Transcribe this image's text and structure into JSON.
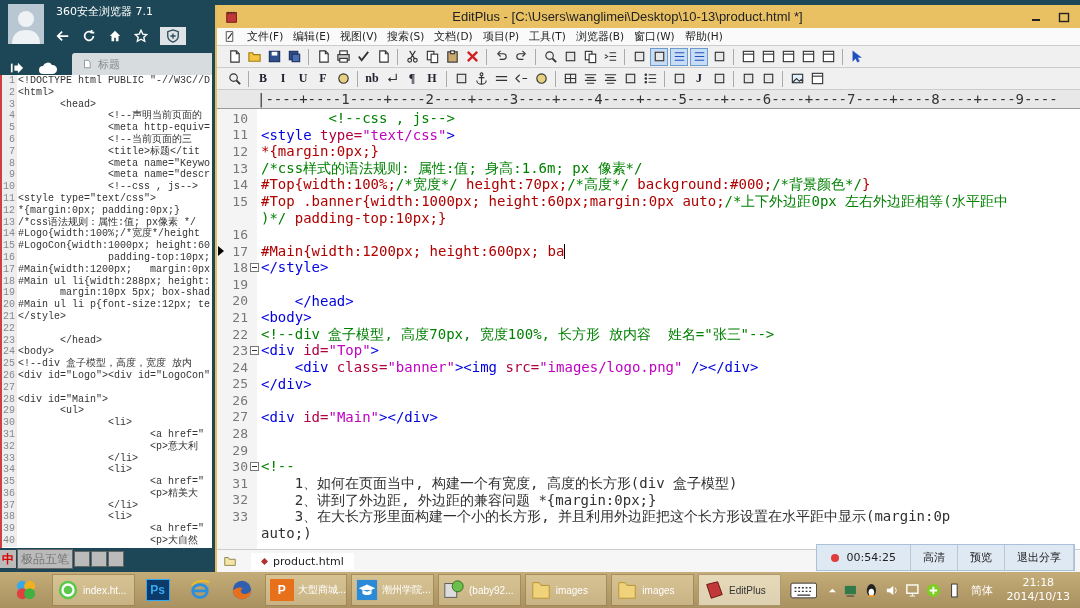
{
  "browser": {
    "title": "360安全浏览器 7.1",
    "tab": "标题",
    "lines": [
      {
        "num": "1",
        "text": "<!DOCTYPE html PUBLIC \"-//W3C//D"
      },
      {
        "num": "2",
        "text": "<html>"
      },
      {
        "num": "3",
        "text": "       <head>"
      },
      {
        "num": "4",
        "text": "               <!--声明当前页面的"
      },
      {
        "num": "5",
        "text": "               <meta http-equiv="
      },
      {
        "num": "6",
        "text": "               <!--当前页面的三"
      },
      {
        "num": "7",
        "text": "               <title>标题</tit"
      },
      {
        "num": "8",
        "text": "               <meta name=\"Keywo"
      },
      {
        "num": "9",
        "text": "               <meta name=\"descr"
      },
      {
        "num": "10",
        "text": "               <!--css , js-->"
      },
      {
        "num": "11",
        "text": "<style type=\"text/css\">"
      },
      {
        "num": "12",
        "text": "*{margin:0px; padding:0px;}"
      },
      {
        "num": "13",
        "text": "/*css语法规则：属性:值; px像素 */"
      },
      {
        "num": "14",
        "text": "#Logo{width:100%;/*宽度*/height"
      },
      {
        "num": "15",
        "text": "#LogoCon{width:1000px; height:60"
      },
      {
        "num": "16",
        "text": "               padding-top:10px;"
      },
      {
        "num": "17",
        "text": "#Main{width:1200px;   margin:0px"
      },
      {
        "num": "18",
        "text": "#Main ul li{width:288px; height:"
      },
      {
        "num": "19",
        "text": "       margin:10px 5px; box-shad"
      },
      {
        "num": "20",
        "text": "#Main ul li p{font-size:12px; te"
      },
      {
        "num": "21",
        "text": "</style>"
      },
      {
        "num": "22"
      },
      {
        "num": "23",
        "text": "       </head>"
      },
      {
        "num": "24",
        "text": "<body>"
      },
      {
        "num": "25",
        "text": "<!--div 盒子模型，高度，宽度 放内"
      },
      {
        "num": "26",
        "text": "<div id=\"Logo\"><div id=\"LogoCon\""
      },
      {
        "num": "27"
      },
      {
        "num": "28",
        "text": "<div id=\"Main\">"
      },
      {
        "num": "29",
        "text": "       <ul>"
      },
      {
        "num": "30",
        "text": "               <li>"
      },
      {
        "num": "31",
        "text": "                      <a href=\""
      },
      {
        "num": "32",
        "text": "                      <p>意大利"
      },
      {
        "num": "33",
        "text": "               </li>"
      },
      {
        "num": "34",
        "text": "               <li>"
      },
      {
        "num": "35",
        "text": "                      <a href=\""
      },
      {
        "num": "36",
        "text": "                      <p>精美大"
      },
      {
        "num": "37",
        "text": "               </li>"
      },
      {
        "num": "38",
        "text": "               <li>"
      },
      {
        "num": "39",
        "text": "                      <a href=\""
      },
      {
        "num": "40",
        "text": "                      <p>大自然"
      }
    ]
  },
  "ime": {
    "mode": "中",
    "name": "极品五笔"
  },
  "editor": {
    "title": "EditPlus - [C:\\Users\\wanglimei\\Desktop\\10-13\\product.html *]",
    "menu": [
      "文件(F)",
      "编辑(E)",
      "视图(V)",
      "搜索(S)",
      "文档(D)",
      "项目(P)",
      "工具(T)",
      "浏览器(B)",
      "窗口(W)",
      "帮助(H)"
    ],
    "toolbar_1": [
      {
        "kind": "button",
        "selected": false
      },
      {
        "kind": "button",
        "selected": false
      },
      {
        "kind": "button",
        "selected": false
      },
      {
        "kind": "button",
        "selected": false
      },
      {
        "kind": "sep"
      },
      {
        "kind": "button",
        "selected": false
      },
      {
        "kind": "button",
        "selected": false
      },
      {
        "kind": "button",
        "selected": false
      },
      {
        "kind": "button",
        "selected": false
      },
      {
        "kind": "sep"
      },
      {
        "kind": "button",
        "selected": false
      },
      {
        "kind": "button",
        "selected": false
      },
      {
        "kind": "button",
        "selected": false
      },
      {
        "kind": "button",
        "selected": false
      },
      {
        "kind": "sep"
      },
      {
        "kind": "button",
        "selected": false
      },
      {
        "kind": "button",
        "selected": false
      },
      {
        "kind": "sep"
      },
      {
        "kind": "button",
        "selected": false
      },
      {
        "kind": "button",
        "selected": false
      },
      {
        "kind": "button",
        "selected": false
      },
      {
        "kind": "button",
        "selected": false
      },
      {
        "kind": "sep"
      },
      {
        "kind": "button",
        "selected": false
      },
      {
        "kind": "button",
        "selected": true
      },
      {
        "kind": "button",
        "selected": true
      },
      {
        "kind": "button",
        "selected": true
      },
      {
        "kind": "button",
        "selected": false
      },
      {
        "kind": "sep"
      },
      {
        "kind": "button",
        "selected": false
      },
      {
        "kind": "button",
        "selected": false
      },
      {
        "kind": "button",
        "selected": false
      },
      {
        "kind": "button",
        "selected": false
      },
      {
        "kind": "button",
        "selected": false
      },
      {
        "kind": "sep"
      },
      {
        "kind": "button",
        "selected": false
      }
    ],
    "toolbar_2": [
      {
        "kind": "button"
      },
      {
        "kind": "sep"
      },
      {
        "kind": "text",
        "label": "B"
      },
      {
        "kind": "text",
        "label": "I"
      },
      {
        "kind": "text",
        "label": "U"
      },
      {
        "kind": "text",
        "label": "F"
      },
      {
        "kind": "button"
      },
      {
        "kind": "sep"
      },
      {
        "kind": "text",
        "label": "nb"
      },
      {
        "kind": "button"
      },
      {
        "kind": "text",
        "label": "¶"
      },
      {
        "kind": "text",
        "label": "H"
      },
      {
        "kind": "sep"
      },
      {
        "kind": "button"
      },
      {
        "kind": "button"
      },
      {
        "kind": "button"
      },
      {
        "kind": "button"
      },
      {
        "kind": "button"
      },
      {
        "kind": "sep"
      },
      {
        "kind": "button"
      },
      {
        "kind": "button"
      },
      {
        "kind": "button"
      },
      {
        "kind": "button"
      },
      {
        "kind": "button"
      },
      {
        "kind": "sep"
      },
      {
        "kind": "button"
      },
      {
        "kind": "text",
        "label": "J"
      },
      {
        "kind": "button"
      },
      {
        "kind": "sep"
      },
      {
        "kind": "button"
      },
      {
        "kind": "button"
      },
      {
        "kind": "sep"
      },
      {
        "kind": "button"
      },
      {
        "kind": "button"
      }
    ],
    "ruler": "|----+----1----+----2----+----3----+----4----+----5----+----6----+----7----+----8----+----9----",
    "lines": [
      {
        "num": "10",
        "tokens": [
          {
            "text": "        <!--css , js-->",
            "kind": "comment"
          }
        ]
      },
      {
        "num": "11",
        "tokens": [
          {
            "text": "<style ",
            "kind": "tag"
          },
          {
            "text": "type=",
            "kind": "attr"
          },
          {
            "text": "\"text/css\"",
            "kind": "val"
          },
          {
            "text": ">",
            "kind": "tag"
          }
        ]
      },
      {
        "num": "12",
        "tokens": [
          {
            "text": "*{margin:0px;}",
            "kind": "css"
          }
        ]
      },
      {
        "num": "13",
        "tokens": [
          {
            "text": "/*css样式的语法规则: 属性:值; 身高:1.6m; px 像素*/",
            "kind": "comment"
          }
        ]
      },
      {
        "num": "14",
        "tokens": [
          {
            "text": "#Top{width:100%;",
            "kind": "css"
          },
          {
            "text": "/*宽度*/",
            "kind": "comment"
          },
          {
            "text": " height:70px;",
            "kind": "css"
          },
          {
            "text": "/*高度*/",
            "kind": "comment"
          },
          {
            "text": " background:#000;",
            "kind": "css"
          },
          {
            "text": "/*背景颜色*/",
            "kind": "comment"
          },
          {
            "text": "}",
            "kind": "css"
          }
        ]
      },
      {
        "num": "15",
        "tokens": [
          {
            "text": "#Top .banner{width:1000px; height:60px;margin:0px auto;",
            "kind": "css"
          },
          {
            "text": "/*上下外边距0px 左右外边距相等(水平距中",
            "kind": "comment"
          }
        ]
      },
      {
        "tokens": [
          {
            "text": ")*/",
            "kind": "comment"
          },
          {
            "text": " padding-top:10px;}",
            "kind": "css"
          }
        ]
      },
      {
        "num": "16"
      },
      {
        "num": "17",
        "marker": true,
        "cursor": true,
        "tokens": [
          {
            "text": "#Main{width:1200px; height:600px; ba",
            "kind": "css"
          }
        ]
      },
      {
        "num": "18",
        "fold": true,
        "tokens": [
          {
            "text": "</style>",
            "kind": "tag"
          }
        ]
      },
      {
        "num": "19"
      },
      {
        "num": "20",
        "tokens": [
          {
            "text": "    </head>",
            "kind": "tag"
          }
        ]
      },
      {
        "num": "21",
        "tokens": [
          {
            "text": "<body>",
            "kind": "tag"
          }
        ]
      },
      {
        "num": "22",
        "tokens": [
          {
            "text": "<!--div 盒子模型, 高度70px, 宽度100%, 长方形 放内容  姓名=\"张三\"-->",
            "kind": "comment"
          }
        ]
      },
      {
        "num": "23",
        "fold": true,
        "tokens": [
          {
            "text": "<div ",
            "kind": "tag"
          },
          {
            "text": "id=",
            "kind": "attr"
          },
          {
            "text": "\"Top\"",
            "kind": "val"
          },
          {
            "text": ">",
            "kind": "tag"
          }
        ]
      },
      {
        "num": "24",
        "tokens": [
          {
            "text": "    <div ",
            "kind": "tag"
          },
          {
            "text": "class=",
            "kind": "attr"
          },
          {
            "text": "\"banner\"",
            "kind": "val"
          },
          {
            "text": "><img ",
            "kind": "tag"
          },
          {
            "text": "src=",
            "kind": "attr"
          },
          {
            "text": "\"images/logo.png\"",
            "kind": "val"
          },
          {
            "text": " /></div>",
            "kind": "tag"
          }
        ]
      },
      {
        "num": "25",
        "tokens": [
          {
            "text": "</div>",
            "kind": "tag"
          }
        ]
      },
      {
        "num": "26"
      },
      {
        "num": "27",
        "tokens": [
          {
            "text": "<div ",
            "kind": "tag"
          },
          {
            "text": "id=",
            "kind": "attr"
          },
          {
            "text": "\"Main\"",
            "kind": "val"
          },
          {
            "text": "></div>",
            "kind": "tag"
          }
        ]
      },
      {
        "num": "28"
      },
      {
        "num": "29"
      },
      {
        "num": "30",
        "fold": true,
        "tokens": [
          {
            "text": "<!--",
            "kind": "comment"
          }
        ]
      },
      {
        "num": "31",
        "tokens": [
          {
            "text": "    1、如何在页面当中, 构建一个有宽度, 高度的长方形(div 盒子模型)",
            "kind": "note"
          }
        ]
      },
      {
        "num": "32",
        "tokens": [
          {
            "text": "    2、讲到了外边距, 外边距的兼容问题 *{margin:0px;}",
            "kind": "note"
          }
        ]
      },
      {
        "num": "33",
        "tokens": [
          {
            "text": "    3、在大长方形里面构建一个小的长方形, 并且利用外边距把这个长方形设置在水平距中显示(margin:0p",
            "kind": "note"
          }
        ]
      },
      {
        "tokens": [
          {
            "text": "auto;)",
            "kind": "note"
          }
        ]
      }
    ],
    "documents": [
      {
        "label": "product.html",
        "selected": true
      }
    ]
  },
  "recorder": {
    "recording": true,
    "time": "00:54:25",
    "buttons": [
      "高清",
      "预览",
      "退出分享"
    ]
  },
  "taskbar": {
    "items": [
      {
        "kind": "orb",
        "selected": false
      },
      {
        "kind": "browser",
        "label": "index.ht...",
        "selected": false
      },
      {
        "kind": "badge",
        "badge": "Ps",
        "selected": false
      },
      {
        "kind": "globe",
        "selected": false
      },
      {
        "kind": "fox",
        "selected": false
      },
      {
        "kind": "badge",
        "badge": "P",
        "label": "大型商城...",
        "selected": false
      },
      {
        "kind": "school",
        "label": "潮州学院...",
        "selected": false
      },
      {
        "kind": "program",
        "label": "(baby92...",
        "selected": false
      },
      {
        "kind": "folder",
        "label": "images",
        "selected": false
      },
      {
        "kind": "folder",
        "label": "images",
        "selected": false
      },
      {
        "kind": "notebook",
        "label": "EditPlus",
        "selected": true
      }
    ],
    "language": "简体",
    "time": "21:18",
    "date": "2014/10/13"
  }
}
